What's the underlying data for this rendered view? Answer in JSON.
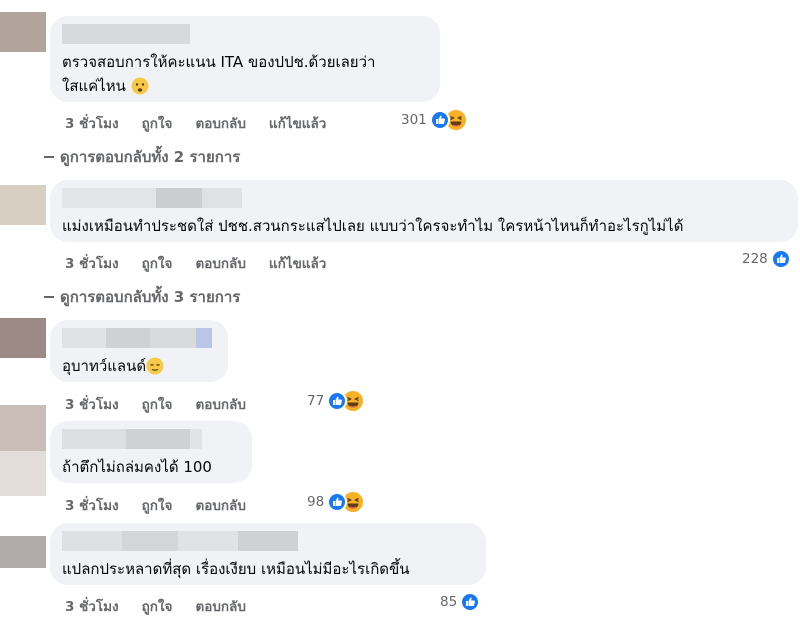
{
  "comments": [
    {
      "text_line1": "ตรวจสอบการให้คะแนน ITA ของปปช.ด้วยเลยว่า",
      "text_line2": "ใสแค่ไหน",
      "time": "3 ชั่วโมง",
      "like": "ถูกใจ",
      "reply": "ตอบกลับ",
      "edited": "แก้ไขแล้ว",
      "reaction_count": "301",
      "reaction_icons": [
        "like-icon",
        "haha-icon"
      ],
      "emoji": "worried-face"
    },
    {
      "text": "แม่งเหมือนทำประชดใส่ ปชช.สวนกระแสไปเลย แบบว่าใครจะทำไม ใครหน้าไหนก็ทำอะไรกูไม่ได้",
      "time": "3 ชั่วโมง",
      "like": "ถูกใจ",
      "reply": "ตอบกลับ",
      "edited": "แก้ไขแล้ว",
      "reaction_count": "228",
      "reaction_icons": [
        "like-icon"
      ]
    },
    {
      "text": "อุบาทว์แลนด์",
      "time": "3 ชั่วโมง",
      "like": "ถูกใจ",
      "reply": "ตอบกลับ",
      "reaction_count": "77",
      "reaction_icons": [
        "like-icon",
        "haha-icon"
      ],
      "emoji": "relieved-face"
    },
    {
      "text": "ถ้าตึกไม่ถล่มคงได้ 100",
      "time": "3 ชั่วโมง",
      "like": "ถูกใจ",
      "reply": "ตอบกลับ",
      "reaction_count": "98",
      "reaction_icons": [
        "like-icon",
        "haha-icon"
      ]
    },
    {
      "text": "แปลกประหลาดที่สุด เรื่องเงียบ เหมือนไม่มีอะไรเกิดขึ้น",
      "time": "3 ชั่วโมง",
      "like": "ถูกใจ",
      "reply": "ตอบกลับ",
      "reaction_count": "85",
      "reaction_icons": [
        "like-icon"
      ]
    }
  ],
  "view_replies": [
    "ดูการตอบกลับทั้ง 2 รายการ",
    "ดูการตอบกลับทั้ง 3 รายการ"
  ],
  "colors": {
    "bubble": "#f0f2f5",
    "meta_text": "#65676b",
    "like_blue": "#1877f2",
    "haha_yellow": "#f7b125"
  }
}
